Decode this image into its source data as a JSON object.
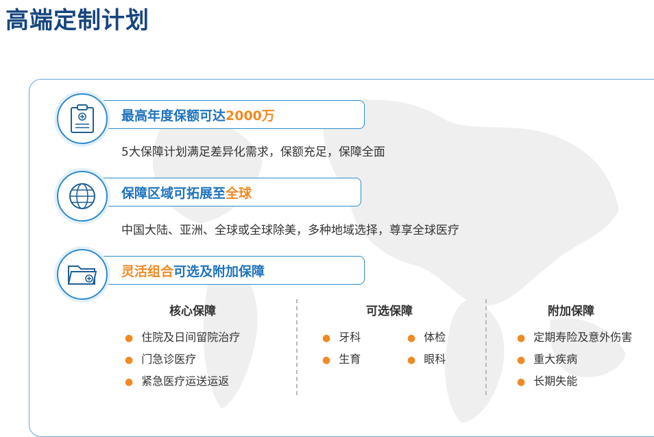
{
  "page": {
    "title": "高端定制计划"
  },
  "features": [
    {
      "title_a": "最高年度保额可达",
      "title_b": "2000万",
      "desc": "5大保障计划满足差异化需求，保额充足，保障全面"
    },
    {
      "title_a": "保障区域可拓展至",
      "title_b": "全球",
      "desc": "中国大陆、亚洲、全球或全球除美，多种地域选择，尊享全球医疗"
    },
    {
      "title_a": "灵活组合",
      "title_b": "可选及附加保障"
    }
  ],
  "columns": {
    "core": {
      "title": "核心保障",
      "items": [
        "住院及日间留院治疗",
        "门急诊医疗",
        "紧急医疗运送运返"
      ]
    },
    "optional": {
      "title": "可选保障",
      "items": [
        "牙科",
        "体检",
        "生育",
        "眼科"
      ]
    },
    "additional": {
      "title": "附加保障",
      "items": [
        "定期寿险及意外伤害",
        "重大疾病",
        "长期失能"
      ]
    }
  },
  "icons": [
    "clipboard-icon",
    "globe-icon",
    "folder-icon"
  ],
  "colors": {
    "title": "#16457f",
    "accent_blue": "#1e73be",
    "accent_orange": "#f08a24",
    "border": "#2b8ad0"
  }
}
